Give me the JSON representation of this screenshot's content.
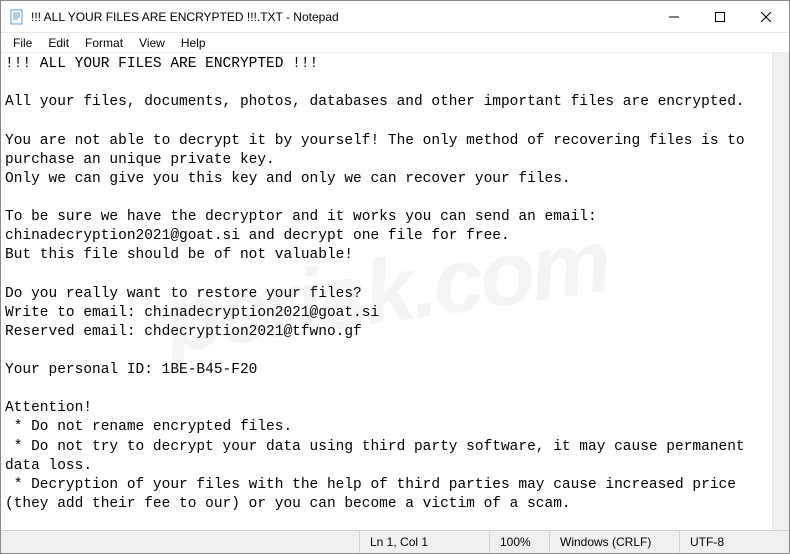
{
  "titlebar": {
    "title": "!!! ALL YOUR FILES ARE ENCRYPTED !!!.TXT - Notepad"
  },
  "menu": {
    "file": "File",
    "edit": "Edit",
    "format": "Format",
    "view": "View",
    "help": "Help"
  },
  "document": {
    "text": "!!! ALL YOUR FILES ARE ENCRYPTED !!!\n\nAll your files, documents, photos, databases and other important files are encrypted.\n\nYou are not able to decrypt it by yourself! The only method of recovering files is to purchase an unique private key.\nOnly we can give you this key and only we can recover your files.\n\nTo be sure we have the decryptor and it works you can send an email: chinadecryption2021@goat.si and decrypt one file for free.\nBut this file should be of not valuable!\n\nDo you really want to restore your files?\nWrite to email: chinadecryption2021@goat.si\nReserved email: chdecryption2021@tfwno.gf\n\nYour personal ID: 1BE-B45-F20\n\nAttention!\n * Do not rename encrypted files.\n * Do not try to decrypt your data using third party software, it may cause permanent data loss.\n * Decryption of your files with the help of third parties may cause increased price (they add their fee to our) or you can become a victim of a scam."
  },
  "statusbar": {
    "position": "Ln 1, Col 1",
    "zoom": "100%",
    "eol": "Windows (CRLF)",
    "encoding": "UTF-8"
  },
  "watermark": "pcrisk.com"
}
